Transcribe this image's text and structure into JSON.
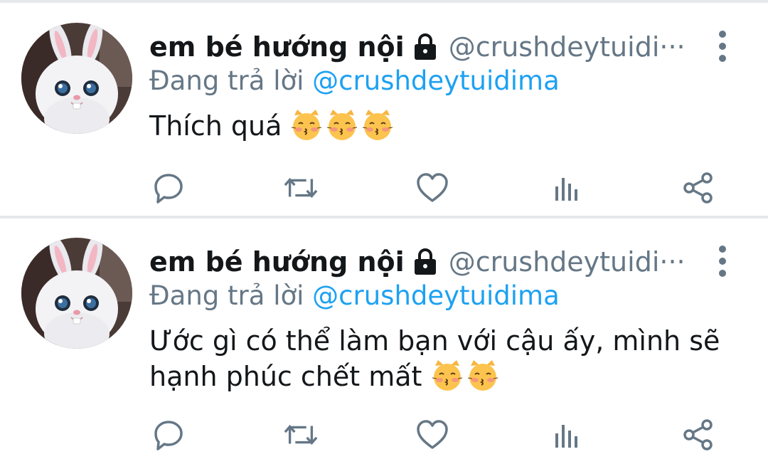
{
  "colors": {
    "accent": "#1da1f2",
    "muted": "#657786",
    "text": "#14171a",
    "divider": "#e6e8ea"
  },
  "tweets": [
    {
      "display_name": "em bé hướng nội",
      "handle": "@crushdeytuidi",
      "handle_overflow": "···",
      "reply_prefix": "Đang trả lời ",
      "reply_to": "@crushdeytuidima",
      "text": "Thích quá ",
      "emoji": [
        "kissing-cat",
        "kissing-cat",
        "kissing-cat"
      ]
    },
    {
      "display_name": "em bé hướng nội",
      "handle": "@crushdeytuidi",
      "handle_overflow": "···",
      "reply_prefix": "Đang trả lời ",
      "reply_to": "@crushdeytuidima",
      "text": "Ước gì có thể làm bạn với cậu ấy, mình sẽ hạnh phúc chết mất ",
      "emoji": [
        "kissing-cat",
        "kissing-cat"
      ]
    }
  ],
  "action_icons": [
    "reply-icon",
    "retweet-icon",
    "like-icon",
    "analytics-icon",
    "share-icon"
  ]
}
